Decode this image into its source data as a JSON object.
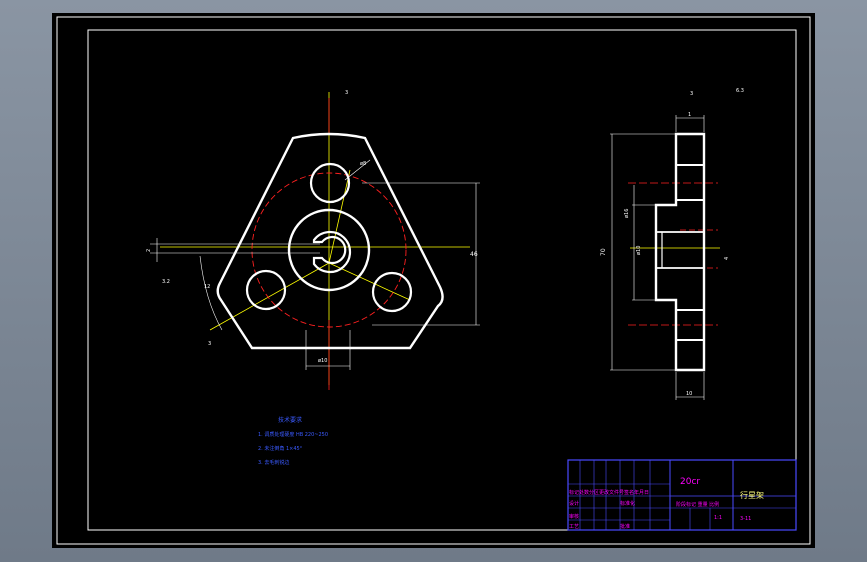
{
  "drawing": {
    "dims": {
      "overall_height": "70",
      "width_right": "10",
      "top_small": "1",
      "hole_dia": "ø8",
      "hub_dia": "ø16",
      "bore": "ø10",
      "height_main": "46",
      "keyway_width": "4",
      "keyway_depth": "2",
      "angle": "12",
      "top_label": "3",
      "roughness": "3.2"
    },
    "roughness_note": "6.3",
    "tech_req": {
      "title": "技术要求",
      "line1": "1. 调质处理硬度 HB 220~250",
      "line2": "2. 未注倒角 1×45°",
      "line3": "3. 去毛刺锐边"
    }
  },
  "title_block": {
    "material": "20cr",
    "part_name": "行星架",
    "drawing_no": "3-11",
    "scale": "1:1",
    "row_left_1": "标记处数分区更改文件号签名年月日",
    "row_left_2": "设计",
    "row_left_3": "审核",
    "row_left_4": "工艺",
    "row_std": "标准化",
    "row_approve": "批准",
    "row_stage": "阶段标记 重量 比例"
  },
  "colors": {
    "outline": "#ffffff",
    "centerline_red": "#ff2020",
    "centerline_yellow": "#ffff00",
    "dimension": "#ffffff",
    "hatch_green": "#00ff00",
    "block_border": "#4a4aff",
    "block_text": "#ff00ff",
    "note_text": "#3a5aff"
  }
}
